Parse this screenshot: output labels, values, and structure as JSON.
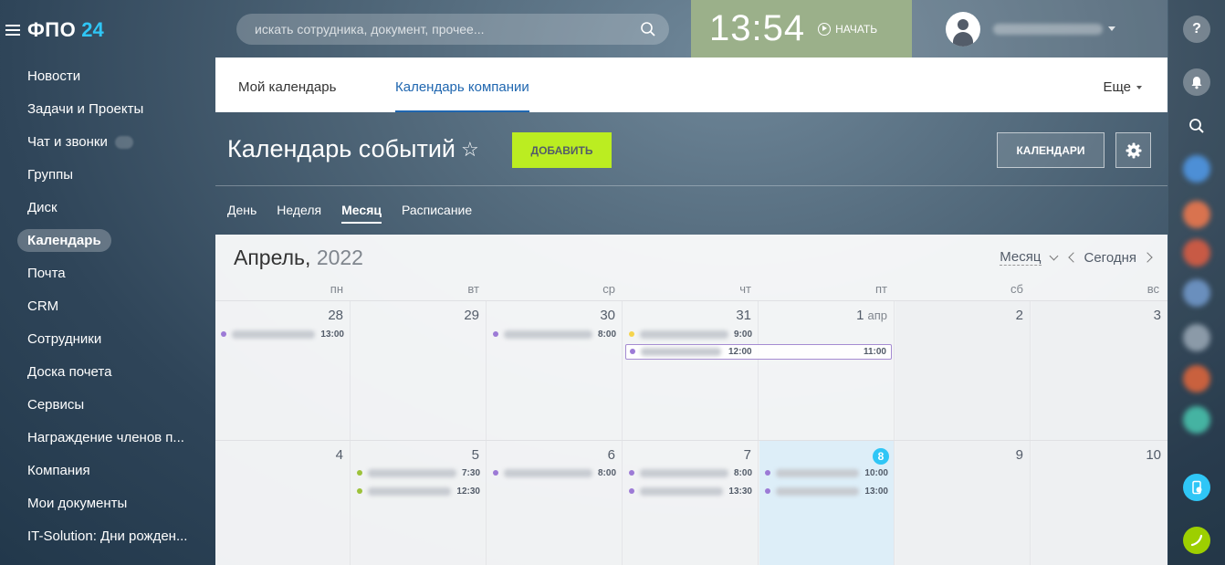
{
  "header": {
    "logo": "ФПО",
    "logo_num": "24",
    "search_placeholder": "искать сотрудника, документ, прочее...",
    "time": "13:54",
    "start_label": "НАЧАТЬ"
  },
  "nav": {
    "items": [
      {
        "label": "Новости"
      },
      {
        "label": "Задачи и Проекты"
      },
      {
        "label": "Чат и звонки"
      },
      {
        "label": "Группы"
      },
      {
        "label": "Диск"
      },
      {
        "label": "Календарь"
      },
      {
        "label": "Почта"
      },
      {
        "label": "CRM"
      },
      {
        "label": "Сотрудники"
      },
      {
        "label": "Доска почета"
      },
      {
        "label": "Сервисы"
      },
      {
        "label": "Награждение членов п..."
      },
      {
        "label": "Компания"
      },
      {
        "label": "Мои документы"
      },
      {
        "label": "IT-Solution: Дни рожден..."
      }
    ]
  },
  "tabs": {
    "my_calendar": "Мой календарь",
    "company_calendar": "Календарь компании",
    "more": "Еще"
  },
  "page": {
    "title": "Календарь событий",
    "add_button": "ДОБАВИТЬ",
    "calendars_button": "КАЛЕНДАРИ"
  },
  "views": {
    "day": "День",
    "week": "Неделя",
    "month": "Месяц",
    "schedule": "Расписание"
  },
  "calendar": {
    "month": "Апрель,",
    "year": "2022",
    "mode": "Месяц",
    "today": "Сегодня",
    "days_of_week": [
      "пн",
      "вт",
      "ср",
      "чт",
      "пт",
      "сб",
      "вс"
    ],
    "week1": {
      "days": [
        "28",
        "29",
        "30",
        "31",
        "1",
        "2",
        "3"
      ],
      "first_month_suffix": "апр",
      "events": {
        "mon": "13:00",
        "wed": "8:00",
        "thu": "9:00",
        "span_start": "12:00",
        "span_end": "11:00"
      }
    },
    "week2": {
      "days": [
        "4",
        "5",
        "6",
        "7",
        "8",
        "9",
        "10"
      ],
      "events": {
        "tue1": "7:30",
        "tue2": "12:30",
        "wed": "8:00",
        "thu1": "8:00",
        "thu2": "13:30",
        "fri1": "10:00",
        "fri2": "13:00"
      }
    }
  },
  "colors": {
    "accent": "#2fc6f6",
    "add_button": "#bbed21",
    "clock_bg": "#9bb08a",
    "event_purple": "#9c7ad6",
    "event_yellow": "#f5d44d",
    "event_green": "#9dc23b",
    "active_tab": "#2067b0"
  },
  "icons": {
    "search": "search-icon",
    "play": "play-icon",
    "star": "star-icon",
    "gear": "gear-icon",
    "help": "help-icon",
    "bell": "bell-icon",
    "phone": "phone-icon"
  }
}
